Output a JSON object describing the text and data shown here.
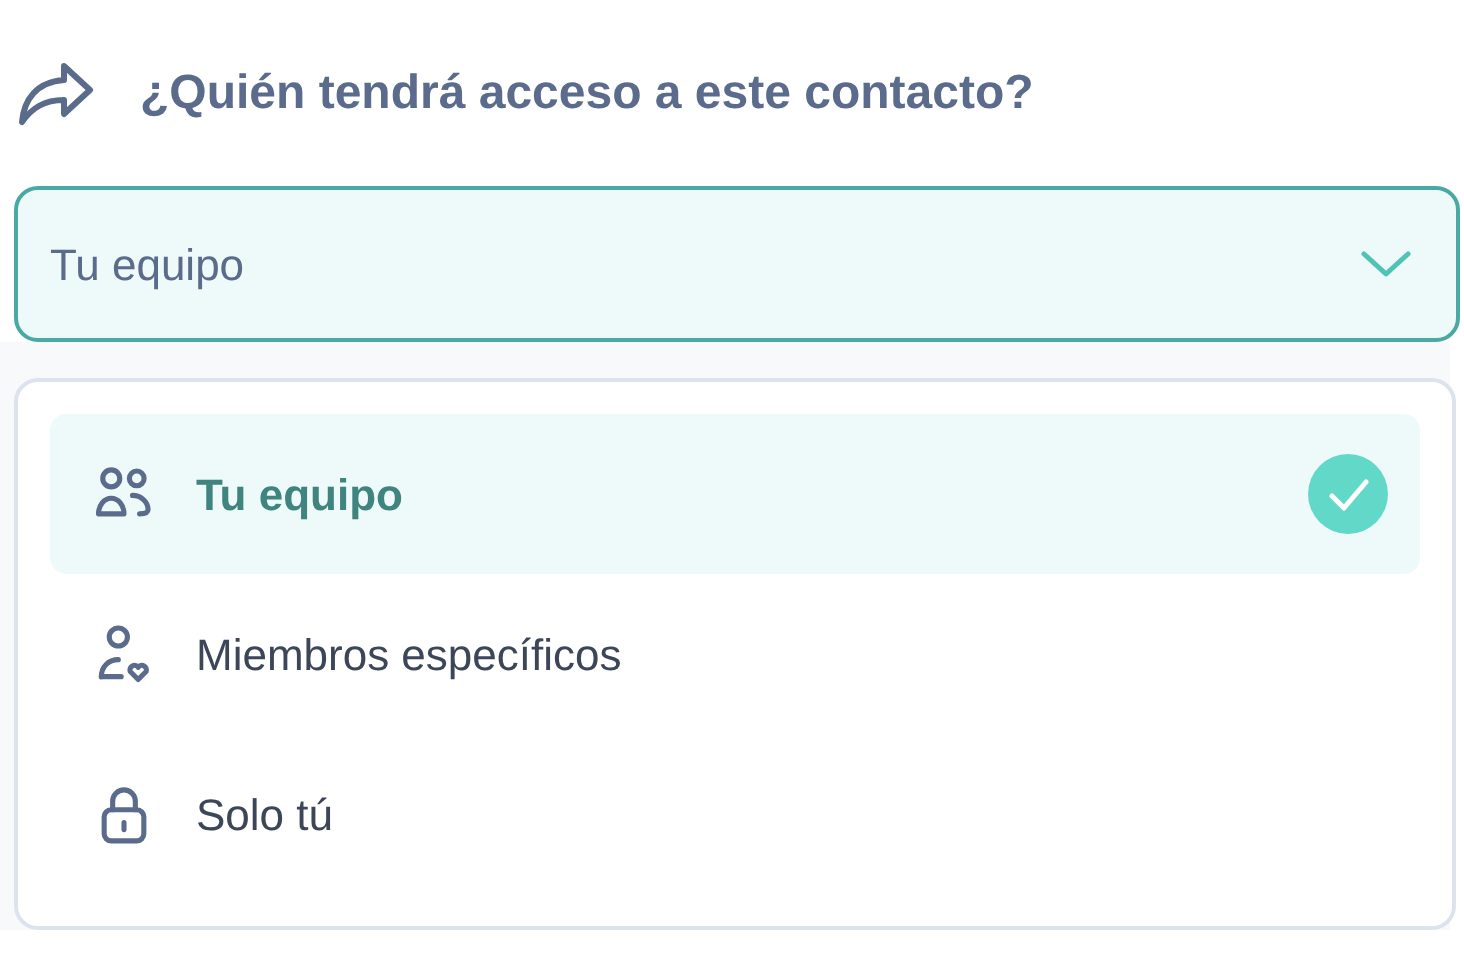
{
  "heading": "¿Quién tendrá acceso a este contacto?",
  "select": {
    "value": "Tu equipo",
    "expanded": true
  },
  "options": [
    {
      "kind": "team",
      "label": "Tu equipo",
      "selected": true
    },
    {
      "kind": "member",
      "label": "Miembros específicos",
      "selected": false
    },
    {
      "kind": "private",
      "label": "Solo tú",
      "selected": false
    }
  ]
}
